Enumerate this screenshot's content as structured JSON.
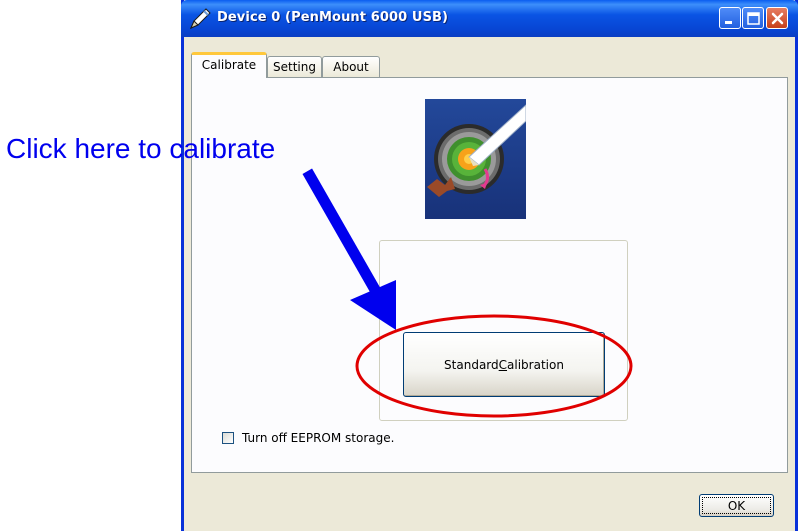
{
  "window": {
    "title": "Device 0 (PenMount 6000 USB)"
  },
  "tabs": [
    {
      "label": "Calibrate",
      "active": true
    },
    {
      "label": "Setting",
      "active": false
    },
    {
      "label": "About",
      "active": false
    }
  ],
  "calibrate": {
    "standard_calibration_prefix": "Standard ",
    "standard_calibration_underlined": "C",
    "standard_calibration_suffix": "alibration",
    "eeprom_checkbox_label": "Turn off EEPROM storage.",
    "eeprom_checked": false
  },
  "footer": {
    "ok_label": "OK"
  },
  "annotation": {
    "text": "Click here to calibrate",
    "text_color": "#0000ee",
    "arrow_color": "#0000ee",
    "ellipse_color": "#e00000"
  },
  "colors": {
    "titlebar": "#0845d3",
    "window_bg": "#ece9d8",
    "active_tab_accent": "#ffc83c",
    "logo_bg": "#1f3c8a"
  },
  "icons": {
    "title": "pen-icon",
    "logo": "target-calibration-logo",
    "minimize": "minimize-icon",
    "maximize": "maximize-icon",
    "close": "close-icon"
  }
}
